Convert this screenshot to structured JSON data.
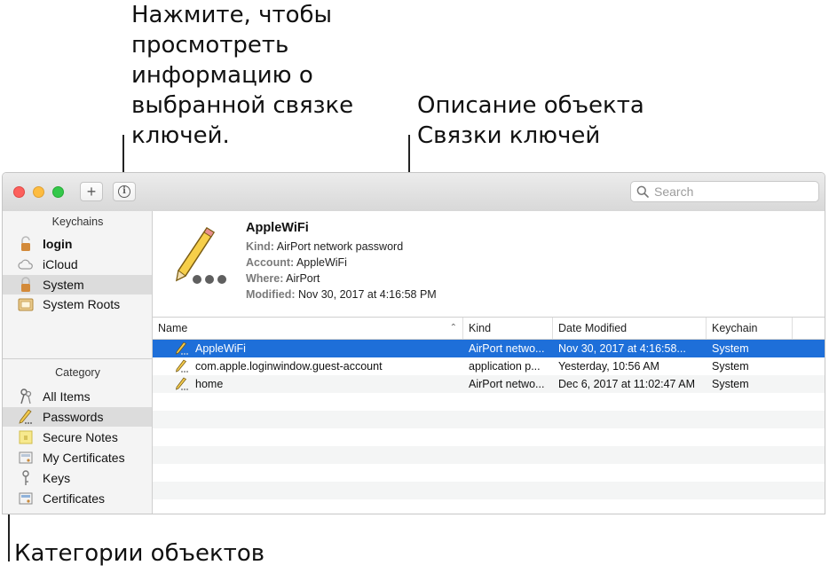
{
  "callouts": {
    "info": "Нажмите, чтобы просмотреть информацию о выбранной связке ключей.",
    "description": "Описание объекта Связки ключей",
    "categories": "Категории объектов"
  },
  "toolbar": {
    "add_label": "+",
    "info_label": "i",
    "search_placeholder": "Search"
  },
  "sidebar": {
    "keychains_header": "Keychains",
    "keychains": [
      {
        "label": "login",
        "icon": "lock-open-icon"
      },
      {
        "label": "iCloud",
        "icon": "cloud-icon"
      },
      {
        "label": "System",
        "icon": "lock-icon"
      },
      {
        "label": "System Roots",
        "icon": "certificate-folder-icon"
      }
    ],
    "category_header": "Category",
    "categories": [
      {
        "label": "All Items",
        "icon": "keys-icon"
      },
      {
        "label": "Passwords",
        "icon": "pencil-icon"
      },
      {
        "label": "Secure Notes",
        "icon": "note-icon"
      },
      {
        "label": "My Certificates",
        "icon": "certificate-icon"
      },
      {
        "label": "Keys",
        "icon": "key-icon"
      },
      {
        "label": "Certificates",
        "icon": "certificate-icon"
      }
    ],
    "selected_keychain": "System",
    "selected_category": "Passwords"
  },
  "detail": {
    "title": "AppleWiFi",
    "kind_key": "Kind:",
    "kind": "AirPort network password",
    "account_key": "Account:",
    "account": "AppleWiFi",
    "where_key": "Where:",
    "where": "AirPort",
    "modified_key": "Modified:",
    "modified": "Nov 30, 2017 at 4:16:58 PM"
  },
  "table": {
    "columns": [
      "Name",
      "Kind",
      "Date Modified",
      "Keychain"
    ],
    "rows": [
      {
        "name": "AppleWiFi",
        "kind": "AirPort netwo...",
        "date": "Nov 30, 2017 at 4:16:58...",
        "keychain": "System"
      },
      {
        "name": "com.apple.loginwindow.guest-account",
        "kind": "application p...",
        "date": "Yesterday, 10:56 AM",
        "keychain": "System"
      },
      {
        "name": "home",
        "kind": "AirPort netwo...",
        "date": "Dec 6, 2017 at 11:02:47 AM",
        "keychain": "System"
      }
    ]
  },
  "colors": {
    "selection": "#1e6fd9",
    "close": "#fc605c",
    "minimize": "#fdbc40",
    "maximize": "#34c84a"
  }
}
